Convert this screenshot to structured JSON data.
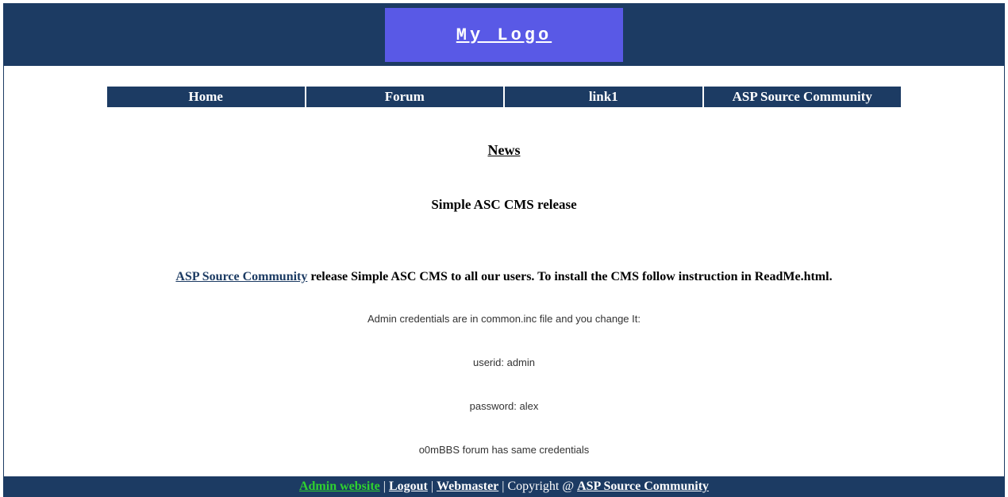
{
  "header": {
    "logo_text": "My Logo"
  },
  "nav": {
    "items": [
      {
        "label": "Home"
      },
      {
        "label": "Forum"
      },
      {
        "label": "link1"
      },
      {
        "label": "ASP Source Community"
      }
    ]
  },
  "content": {
    "section_title": "News",
    "article_title": "Simple ASC CMS release",
    "release_link_text": "ASP Source Community",
    "release_text_after": " release Simple ASC CMS to all our users. To install the CMS follow instruction in ReadMe.html.",
    "lines": [
      "Admin credentials are in common.inc file and you change It:",
      "userid: admin",
      "password: alex",
      "o0mBBS forum has same credentials"
    ]
  },
  "footer": {
    "admin_label": "Admin website",
    "logout_label": "Logout",
    "webmaster_label": "Webmaster",
    "copyright_prefix": " | Copyright @ ",
    "asc_label": "ASP Source Community",
    "separator": " | "
  }
}
